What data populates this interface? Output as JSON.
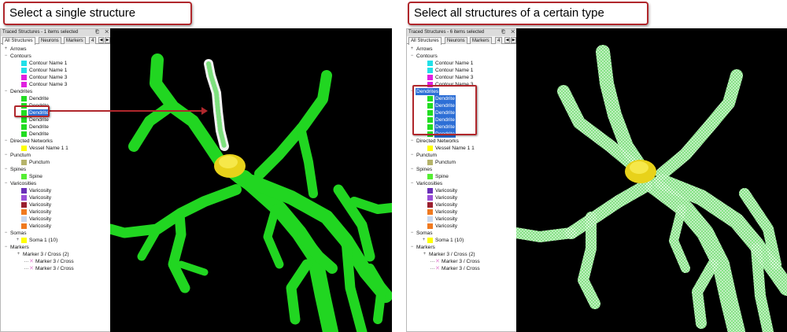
{
  "left": {
    "callout": "Select a single structure",
    "panel_title": "Traced Structures - 1 items selected",
    "tabs": [
      "All Structures",
      "Neurons",
      "Markers",
      "4"
    ],
    "window_buttons": "⎗ ✕"
  },
  "right": {
    "callout": "Select all structures of a certain type",
    "panel_title": "Traced Structures - 6 items selected",
    "tabs": [
      "All Structures",
      "Neurons",
      "Markers",
      "4"
    ],
    "window_buttons": "⎗ ✕"
  },
  "tree": {
    "arrows": "Arrows",
    "contours": "Contours",
    "contour_items": [
      "Contour Name 1",
      "Contour Name 1",
      "Contour Name 3",
      "Contour Name 3"
    ],
    "dendrites": "Dendrites",
    "dendrite_item": "Dendrite",
    "directed_networks": "Directed Networks",
    "vessel": "Vessel Name 1 1",
    "punctum_cat": "Punctum",
    "punctum": "Punctum",
    "spines": "Spines",
    "spine": "Spine",
    "varicosities": "Varicosities",
    "varicosity": "Varicosity",
    "somas": "Somas",
    "soma": "Soma 1 (10)",
    "markers": "Markers",
    "marker_group": "Marker 3 / Cross (2)",
    "marker_item": "Marker 3 / Cross"
  },
  "colors": {
    "accent_red": "#b0272c",
    "selection_blue": "#2d6fd6",
    "dendrite_green": "#22dd22",
    "soma_yellow": "#e8d21a",
    "contours": [
      "#22e0e8",
      "#22e0e8",
      "#e020e0",
      "#e020e0"
    ],
    "dendrites": [
      "#22dd22",
      "#22dd22",
      "#22dd22",
      "#22dd22",
      "#22dd22",
      "#22dd22"
    ],
    "vessel": "#ffff00",
    "punctum": "#b5b36a",
    "spine": "#55ee33",
    "varicosities": [
      "#6a2fb8",
      "#9a4fd8",
      "#9a2030",
      "#f07a20",
      "#c8d8f0",
      "#f07a20"
    ],
    "soma": "#ffff00"
  },
  "selection": {
    "left_selected_dendrite": 2,
    "right_all_dendrites_selected": true
  },
  "icons": [
    "expand-plus-icon",
    "collapse-minus-icon",
    "cross-marker-icon",
    "window-pin-icon",
    "window-close-icon",
    "tab-scroll-left-icon",
    "tab-scroll-right-icon"
  ]
}
